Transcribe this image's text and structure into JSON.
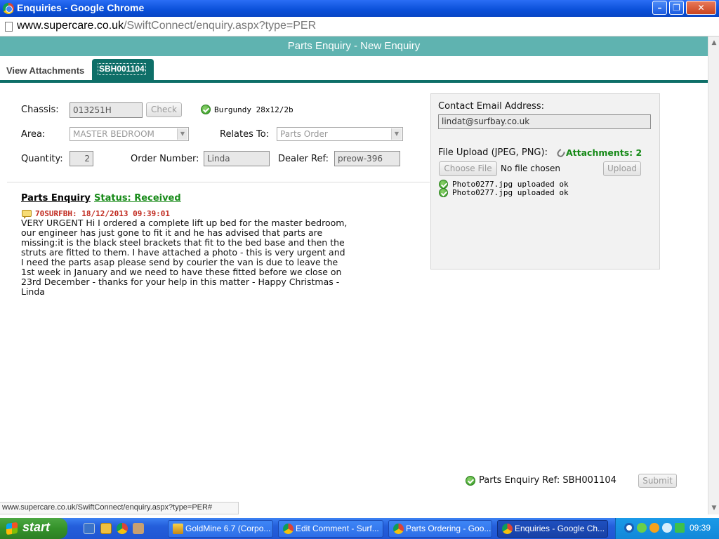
{
  "window": {
    "title": "Enquiries - Google Chrome"
  },
  "browser": {
    "url_domain": "www.supercare.co.uk",
    "url_path": "/SwiftConnect/enquiry.aspx?type=PER",
    "status_link": "www.supercare.co.uk/SwiftConnect/enquiry.aspx?type=PER#"
  },
  "page": {
    "header": "Parts Enquiry - New Enquiry",
    "tabs": [
      {
        "label": "View Attachments",
        "active": false
      },
      {
        "label": "SBH001104",
        "active": true
      }
    ],
    "form": {
      "chassis_label": "Chassis:",
      "chassis_value": "013251H",
      "check_button": "Check",
      "vehicle_info": "Burgundy 28x12/2b",
      "area_label": "Area:",
      "area_value": "MASTER BEDROOM",
      "relates_label": "Relates To:",
      "relates_value": "Parts Order",
      "quantity_label": "Quantity:",
      "quantity_value": "2",
      "order_number_label": "Order Number:",
      "order_number_value": "Linda",
      "dealer_ref_label": "Dealer Ref:",
      "dealer_ref_value": "preow-396"
    },
    "contact": {
      "email_label": "Contact Email Address:",
      "email_value": "lindat@surfbay.co.uk",
      "upload_label": "File Upload (JPEG, PNG):",
      "attachments_label": "Attachments: 2",
      "choose_file_button": "Choose File",
      "no_file_text": "No file chosen",
      "upload_button": "Upload",
      "uploads": [
        "Photo0277.jpg uploaded ok",
        "Photo0277.jpg uploaded ok"
      ]
    },
    "enquiry": {
      "title": "Parts Enquiry",
      "status": "Status: Received",
      "comment_meta": "70SURFBH: 18/12/2013 09:39:01",
      "comment_body": "VERY URGENT Hi I ordered a complete lift up bed for the master bedroom, our engineer has just gone to fit it and he has advised that parts are missing:it is the black steel brackets that fit to the bed base and then the struts are fitted to them. I have attached a photo - this is very urgent and I need the parts asap please send by courier the van is due to leave the 1st week in January and we need to have these fitted before we close on 23rd December - thanks for your help in this matter - Happy Christmas - Linda"
    },
    "footer": {
      "ref_text": "Parts Enquiry Ref: SBH001104",
      "submit_button": "Submit"
    }
  },
  "taskbar": {
    "start_label": "start",
    "tasks": [
      {
        "label": "GoldMine 6.7 (Corpo...",
        "icon": "goldmine-icon",
        "active": false
      },
      {
        "label": "Edit Comment - Surf...",
        "icon": "chrome-icon",
        "active": false
      },
      {
        "label": "Parts Ordering - Goo...",
        "icon": "chrome-icon",
        "active": false
      },
      {
        "label": "Enquiries - Google Ch...",
        "icon": "chrome-icon",
        "active": true
      }
    ],
    "clock": "09:39"
  },
  "colors": {
    "header_teal": "#5fb3b0",
    "tab_dark_teal": "#0e6f68",
    "status_green": "#178a18",
    "comment_red": "#c0281d"
  }
}
